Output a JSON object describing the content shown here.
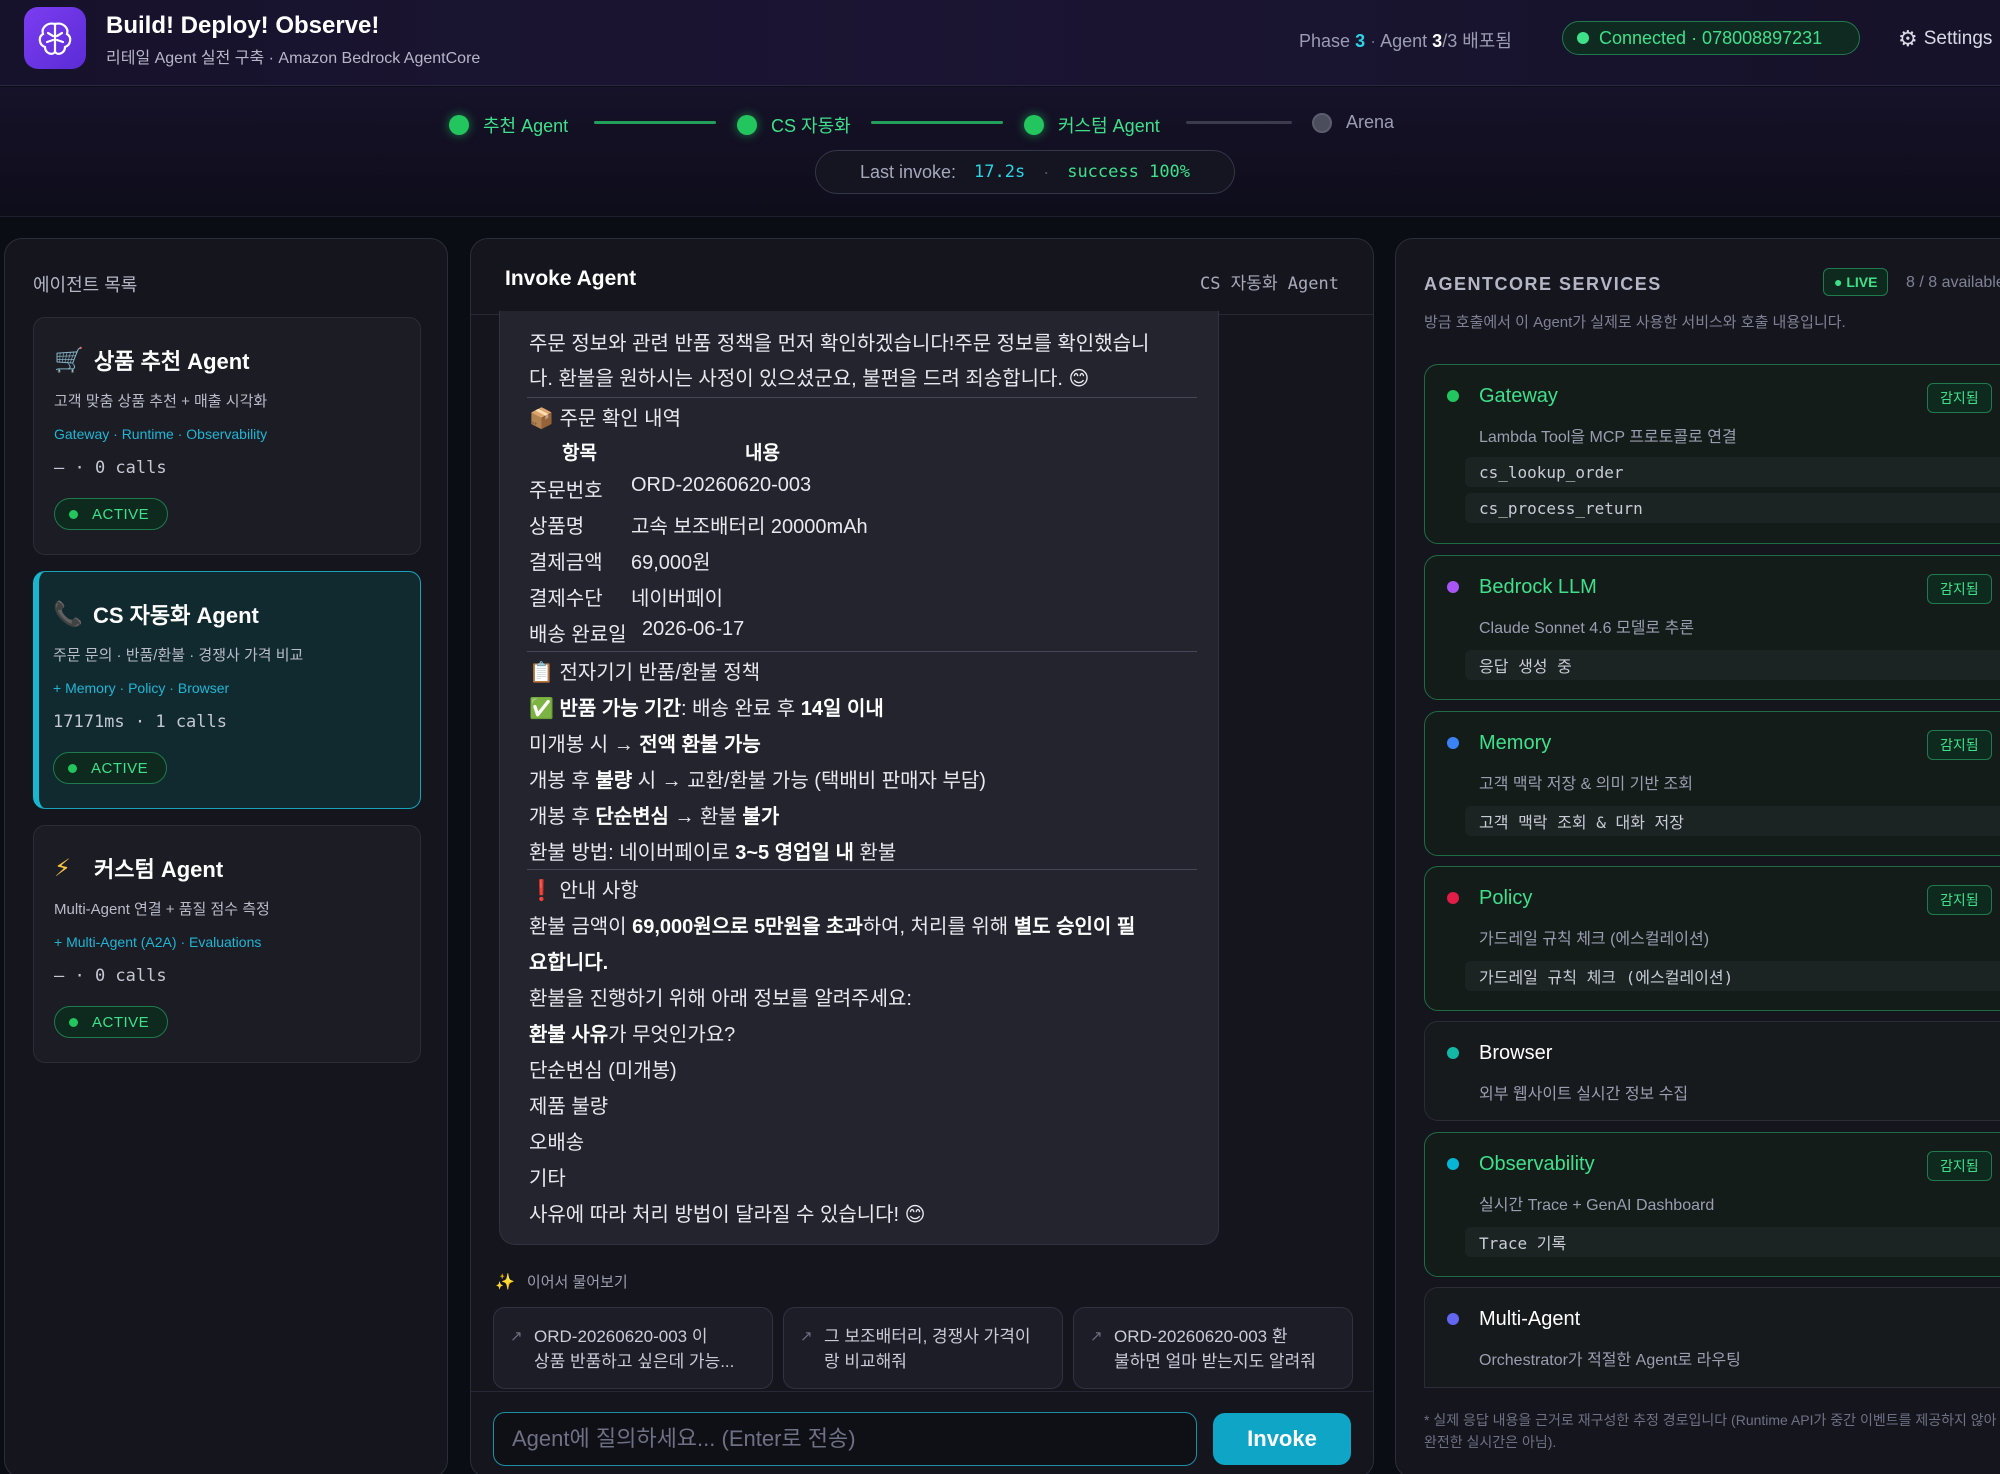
{
  "header": {
    "title": "Build! Deploy! Observe!",
    "subtitle": "리테일 Agent 실전 구축 · Amazon Bedrock AgentCore",
    "phase_label": "Phase",
    "phase_value": "3",
    "agent_label": "Agent",
    "agent_done": "3",
    "agent_total": "/3 배포됨",
    "connection": "Connected · 078008897231",
    "settings": "Settings"
  },
  "progress": {
    "steps": [
      {
        "label": "추천 Agent",
        "state": "done"
      },
      {
        "label": "CS 자동화",
        "state": "done"
      },
      {
        "label": "커스텀 Agent",
        "state": "done"
      },
      {
        "label": "Arena",
        "state": "pending"
      }
    ],
    "last_invoke_label": "Last invoke:",
    "last_invoke_value": "17.2s",
    "success_value": "success 100%"
  },
  "left": {
    "title": "에이전트 목록",
    "agents": [
      {
        "icon": "🛒",
        "name": "상품 추천 Agent",
        "desc": "고객 맞춤 상품 추천 + 매출 시각화",
        "tags": "Gateway · Runtime · Observability",
        "stat": "— · 0 calls",
        "status": "ACTIVE"
      },
      {
        "icon": "📞",
        "name": "CS 자동화 Agent",
        "desc": "주문 문의 · 반품/환불 · 경쟁사 가격 비교",
        "tags": "+ Memory · Policy · Browser",
        "stat": "17171ms · 1 calls",
        "status": "ACTIVE"
      },
      {
        "icon": "⚡",
        "name": "커스텀 Agent",
        "desc": "Multi-Agent 연결 + 품질 점수 측정",
        "tags": "+ Multi-Agent (A2A) · Evaluations",
        "stat": "— · 0 calls",
        "status": "ACTIVE"
      }
    ]
  },
  "chat": {
    "title": "Invoke Agent",
    "agent_name": "CS 자동화 Agent",
    "intro_1": "주문 정보와 관련 반품 정책을 먼저 확인하겠습니다!주문 정보를 확인했습니",
    "intro_2": "다. 환불을 원하시는 사정이 있으셨군요, 불편을 드려 죄송합니다. 😊",
    "order_heading": "📦 주문 확인 내역",
    "table_head_key": "항목",
    "table_head_val": "내용",
    "order_rows": [
      {
        "k": "주문번호",
        "v": "ORD-20260620-003"
      },
      {
        "k": "상품명",
        "v": "고속 보조배터리 20000mAh"
      },
      {
        "k": "결제금액",
        "v": "69,000원"
      },
      {
        "k": "결제수단",
        "v": "네이버페이"
      },
      {
        "k": "배송 완료일",
        "v": "2026-06-17"
      }
    ],
    "policy_heading": "📋 전자기기 반품/환불 정책",
    "policy_1a": "✅ 반품 가능 기간",
    "policy_1b": ": 배송 완료 후 ",
    "policy_1c": "14일 이내",
    "policy_2a": "미개봉 시 → ",
    "policy_2b": "전액 환불 가능",
    "policy_3a": "개봉 후 ",
    "policy_3b": "불량",
    "policy_3c": " 시 → 교환/환불 가능 (택배비 판매자 부담)",
    "policy_4a": "개봉 후 ",
    "policy_4b": "단순변심",
    "policy_4c": " → 환불 ",
    "policy_4d": "불가",
    "policy_5a": "환불 방법: 네이버페이로 ",
    "policy_5b": "3~5 영업일 내",
    "policy_5c": " 환불",
    "notice_heading": "❗ 안내 사항",
    "notice_1a": "환불 금액이 ",
    "notice_1b": "69,000원으로 5만원을 초과",
    "notice_1c": "하여, 처리를 위해 ",
    "notice_1d": "별도 승인이 필",
    "notice_2": "요합니다.",
    "ask": "환불을 진행하기 위해 아래 정보를 알려주세요:",
    "reason_a": "환불 사유",
    "reason_b": "가 무엇인가요?",
    "options": [
      "단순변심 (미개봉)",
      "제품 불량",
      "오배송",
      "기타"
    ],
    "closing": "사유에 따라 처리 방법이 달라질 수 있습니다! 😊",
    "followup_label": "이어서 물어보기",
    "suggestions": [
      {
        "l1": "ORD-20260620-003 이",
        "l2": "상품 반품하고 싶은데 가능..."
      },
      {
        "l1": "그 보조배터리, 경쟁사 가격이",
        "l2": "랑 비교해줘"
      },
      {
        "l1": "ORD-20260620-003 환",
        "l2": "불하면 얼마 받는지도 알려줘"
      }
    ],
    "input_placeholder": "Agent에 질의하세요... (Enter로 전송)",
    "invoke_button": "Invoke"
  },
  "services": {
    "title": "AGENTCORE SERVICES",
    "live": "● LIVE",
    "available": "8 / 8 available",
    "subtitle": "방금 호출에서 이 Agent가 실제로 사용한 서비스와 호출 내용입니다.",
    "detected_label": "감지됨",
    "items": [
      {
        "name": "Gateway",
        "desc": "Lambda Tool을 MCP 프로토콜로 연결",
        "color": "#22c55e",
        "detected": true,
        "tools": [
          "cs_lookup_order",
          "cs_process_return"
        ]
      },
      {
        "name": "Bedrock LLM",
        "desc": "Claude Sonnet 4.6 모델로 추론",
        "color": "#a855f7",
        "detected": true,
        "tools": [
          "응답 생성 중"
        ]
      },
      {
        "name": "Memory",
        "desc": "고객 맥락 저장 & 의미 기반 조회",
        "color": "#3b82f6",
        "detected": true,
        "tools": [
          "고객 맥락 조회 & 대화 저장"
        ]
      },
      {
        "name": "Policy",
        "desc": "가드레일 규칙 체크 (에스컬레이션)",
        "color": "#e11d48",
        "detected": true,
        "tools": [
          "가드레일 규칙 체크 (에스컬레이션)"
        ]
      },
      {
        "name": "Browser",
        "desc": "외부 웹사이트 실시간 정보 수집",
        "color": "#14b8a6",
        "detected": false,
        "tools": []
      },
      {
        "name": "Observability",
        "desc": "실시간 Trace + GenAI Dashboard",
        "color": "#06b6d4",
        "detected": true,
        "tools": [
          "Trace 기록"
        ]
      },
      {
        "name": "Multi-Agent",
        "desc": "Orchestrator가 적절한 Agent로 라우팅",
        "color": "#6366f1",
        "detected": false,
        "tools": []
      }
    ],
    "footnote": "* 실제 응답 내용을 근거로 재구성한 추정 경로입니다 (Runtime API가 중간 이벤트를 제공하지 않아 완전한 실시간은 아님)."
  }
}
